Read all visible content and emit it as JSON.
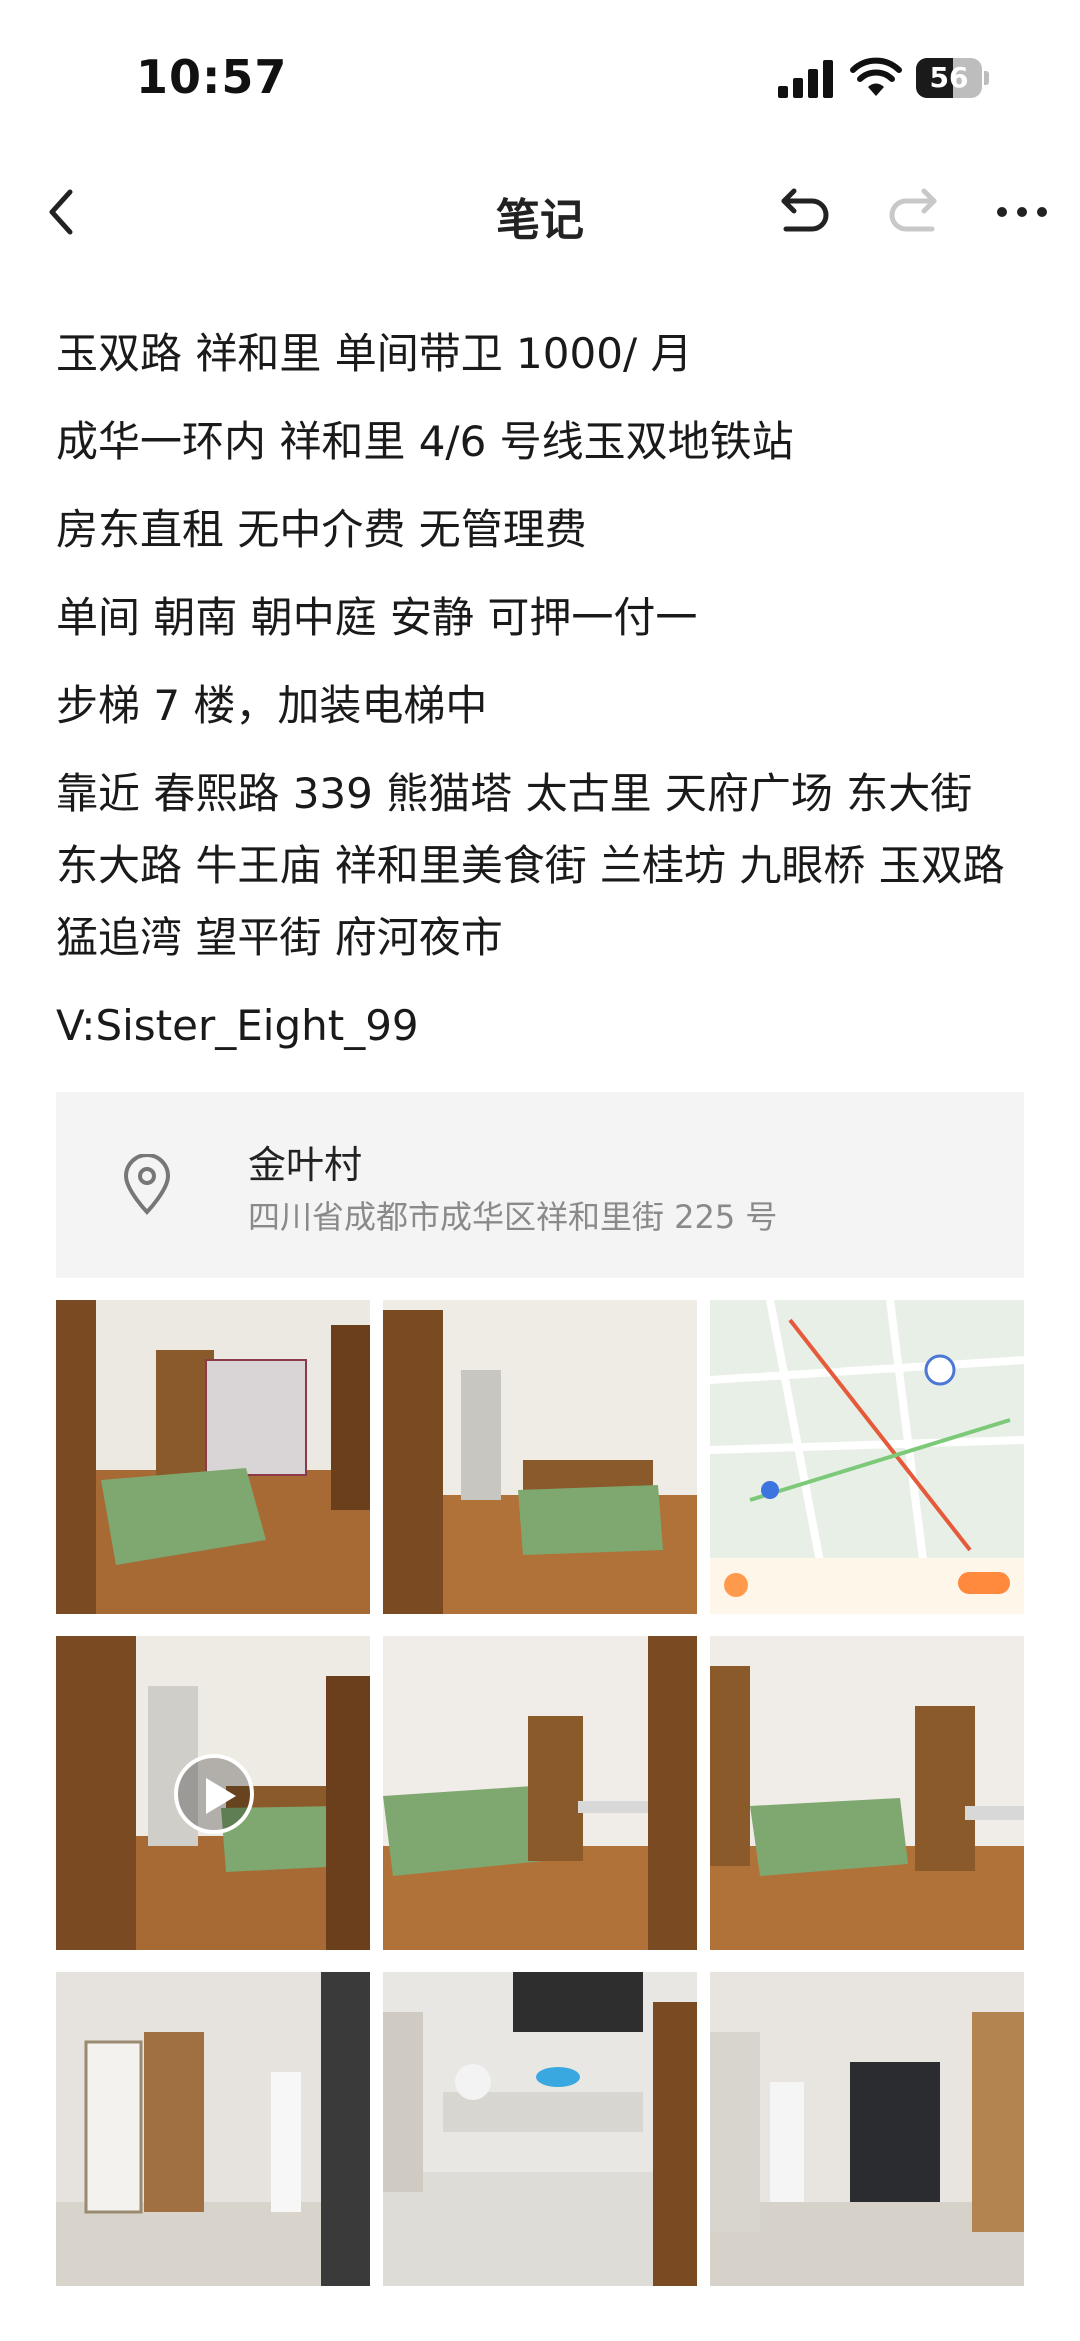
{
  "status_bar": {
    "time": "10:57",
    "battery": "56",
    "battery_level_percent": 56
  },
  "nav": {
    "title": "笔记",
    "back_icon": "chevron-left-icon",
    "undo_icon": "undo-icon",
    "redo_icon": "redo-icon",
    "more_icon": "more-icon"
  },
  "note": {
    "lines": [
      "玉双路 祥和里 单间带卫 1000/ 月",
      "成华一环内 祥和里 4/6 号线玉双地铁站",
      "房东直租 无中介费 无管理费",
      "单间 朝南 朝中庭 安静 可押一付一",
      "步梯 7 楼，加装电梯中",
      "靠近 春熙路 339 熊猫塔 太古里 天府广场 东大街 东大路 牛王庙 祥和里美食街 兰桂坊 九眼桥 玉双路 猛追湾 望平街 府河夜市",
      "V:Sister_Eight_99"
    ]
  },
  "location": {
    "name": "金叶村",
    "address": "四川省成都市成华区祥和里街 225 号",
    "icon": "location-pin-icon"
  },
  "photos": [
    {
      "kind": "room"
    },
    {
      "kind": "room"
    },
    {
      "kind": "map"
    },
    {
      "kind": "video"
    },
    {
      "kind": "room"
    },
    {
      "kind": "room"
    },
    {
      "kind": "room"
    },
    {
      "kind": "kitchen"
    },
    {
      "kind": "room"
    }
  ],
  "colors": {
    "text": "#1a1a1a",
    "address_gray": "#8a8a8a",
    "card_bg": "#f4f4f4",
    "disabled_icon": "#c8c8c8"
  }
}
